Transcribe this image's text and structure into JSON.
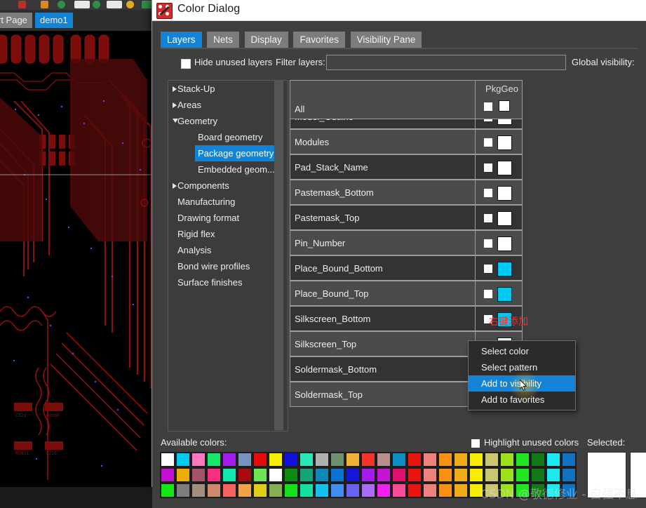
{
  "background_app": {
    "tabs": [
      {
        "label": "rt Page",
        "active": false
      },
      {
        "label": "demo1",
        "active": true
      }
    ],
    "canvas_name": "pcb-layout-canvas"
  },
  "window": {
    "title": "Color Dialog",
    "icon": "color-dialog-icon"
  },
  "tabs": [
    {
      "label": "Layers",
      "active": true
    },
    {
      "label": "Nets",
      "active": false
    },
    {
      "label": "Display",
      "active": false
    },
    {
      "label": "Favorites",
      "active": false
    },
    {
      "label": "Visibility Pane",
      "active": false
    }
  ],
  "filter_row": {
    "hide_unused_label": "Hide unused layers",
    "hide_unused_checked": false,
    "filter_label": "Filter layers:",
    "filter_value": "",
    "filter_placeholder": "",
    "global_visibility_label": "Global visibility:"
  },
  "tree": [
    {
      "label": "Stack-Up",
      "indent": 0,
      "arrow": "closed",
      "selected": false
    },
    {
      "label": "Areas",
      "indent": 0,
      "arrow": "closed",
      "selected": false
    },
    {
      "label": "Geometry",
      "indent": 0,
      "arrow": "open",
      "selected": false
    },
    {
      "label": "Board geometry",
      "indent": 1,
      "arrow": "none",
      "selected": false
    },
    {
      "label": "Package geometry",
      "indent": 1,
      "arrow": "none",
      "selected": true
    },
    {
      "label": "Embedded geom...",
      "indent": 1,
      "arrow": "none",
      "selected": false
    },
    {
      "label": "Components",
      "indent": 0,
      "arrow": "closed",
      "selected": false
    },
    {
      "label": "Manufacturing",
      "indent": 0,
      "arrow": "none",
      "selected": false
    },
    {
      "label": "Drawing format",
      "indent": 0,
      "arrow": "none",
      "selected": false
    },
    {
      "label": "Rigid flex",
      "indent": 0,
      "arrow": "none",
      "selected": false
    },
    {
      "label": "Analysis",
      "indent": 0,
      "arrow": "none",
      "selected": false
    },
    {
      "label": "Bond wire profiles",
      "indent": 0,
      "arrow": "none",
      "selected": false
    },
    {
      "label": "Surface finishes",
      "indent": 0,
      "arrow": "none",
      "selected": false
    }
  ],
  "table": {
    "all_label": "All",
    "column_header": "PkgGeo",
    "header_checkbox_checked": false,
    "header_swatch_color": "#ffffff",
    "rows": [
      {
        "name": "Model_Outline",
        "checked": false,
        "color": "#ffffff"
      },
      {
        "name": "Modules",
        "checked": false,
        "color": "#ffffff"
      },
      {
        "name": "Pad_Stack_Name",
        "checked": false,
        "color": "#ffffff"
      },
      {
        "name": "Pastemask_Bottom",
        "checked": false,
        "color": "#ffffff"
      },
      {
        "name": "Pastemask_Top",
        "checked": false,
        "color": "#ffffff"
      },
      {
        "name": "Pin_Number",
        "checked": false,
        "color": "#ffffff"
      },
      {
        "name": "Place_Bound_Bottom",
        "checked": false,
        "color": "#00c8f0"
      },
      {
        "name": "Place_Bound_Top",
        "checked": false,
        "color": "#00c8f0"
      },
      {
        "name": "Silkscreen_Bottom",
        "checked": false,
        "color": "#00c8f0"
      },
      {
        "name": "Silkscreen_Top",
        "checked": false,
        "color": "#ffffff"
      },
      {
        "name": "Soldermask_Bottom",
        "checked": false,
        "color": "#f764b8"
      },
      {
        "name": "Soldermask_Top",
        "checked": false,
        "color": "#f764b8"
      }
    ]
  },
  "annotation": {
    "text": "右键添加",
    "color": "#ff2b2b"
  },
  "context_menu": {
    "items": [
      {
        "label": "Select color",
        "highlighted": false
      },
      {
        "label": "Select pattern",
        "highlighted": false
      },
      {
        "label": "Add to visibility",
        "highlighted": true
      },
      {
        "label": "Add to favorites",
        "highlighted": false
      }
    ]
  },
  "palette": {
    "available_label": "Available colors:",
    "highlight_unused_label": "Highlight unused colors",
    "highlight_unused_checked": false,
    "selected_label": "Selected:",
    "selected_color": "#ffffff",
    "rows": [
      [
        "#ffffff",
        "#00caf2",
        "#fd78bc",
        "#16e66b",
        "#a41cf0",
        "#7792bf",
        "#e60c0c",
        "#f6ec06",
        "#1212e0",
        "#27e7bb",
        "#b0b0b0",
        "#6f9070",
        "#f0b338",
        "#f4342c",
        "#b98f8c",
        "#0a8ec4",
        "#ea1410",
        "#f0827e",
        "#f79212",
        "#f0ab1c",
        "#f6ec06",
        "#cac770",
        "#9ee01c",
        "#22e622",
        "#117a17",
        "#1ce9ef",
        "#1172c4"
      ],
      [
        "#c210d0",
        "#ecad06",
        "#a4556a",
        "#fb2e84",
        "#13e7b0",
        "#a80b0b",
        "#6ce453",
        "#ffffff",
        "#0d8a13",
        "#13a377",
        "#0c8ab4",
        "#0a72d0",
        "#1616d8",
        "#a51cf0",
        "#c414d4",
        "#e0106e",
        "#ea1410",
        "#f0827e",
        "#f79212",
        "#f0ab1c",
        "#f6ec06",
        "#cac770",
        "#9ee01c",
        "#22e622",
        "#117a17",
        "#1ce9ef",
        "#1172c4"
      ],
      [
        "#14e814",
        "#7e7e7e",
        "#a3907c",
        "#d0886a",
        "#f6625e",
        "#f0a348",
        "#e0ce16",
        "#86b054",
        "#16e016",
        "#14dfa0",
        "#14c2f2",
        "#3e8ff0",
        "#6a62f2",
        "#a86cf6",
        "#f020f0",
        "#fb4c9a",
        "#ea1410",
        "#f0827e",
        "#f79212",
        "#f0ab1c",
        "#f6ec06",
        "#cac770",
        "#9ee01c",
        "#22e622",
        "#117a17",
        "#1ce9ef",
        "#1172c4"
      ]
    ]
  },
  "watermark": {
    "text": "CSDN @敬德修业 - 自强不息"
  }
}
